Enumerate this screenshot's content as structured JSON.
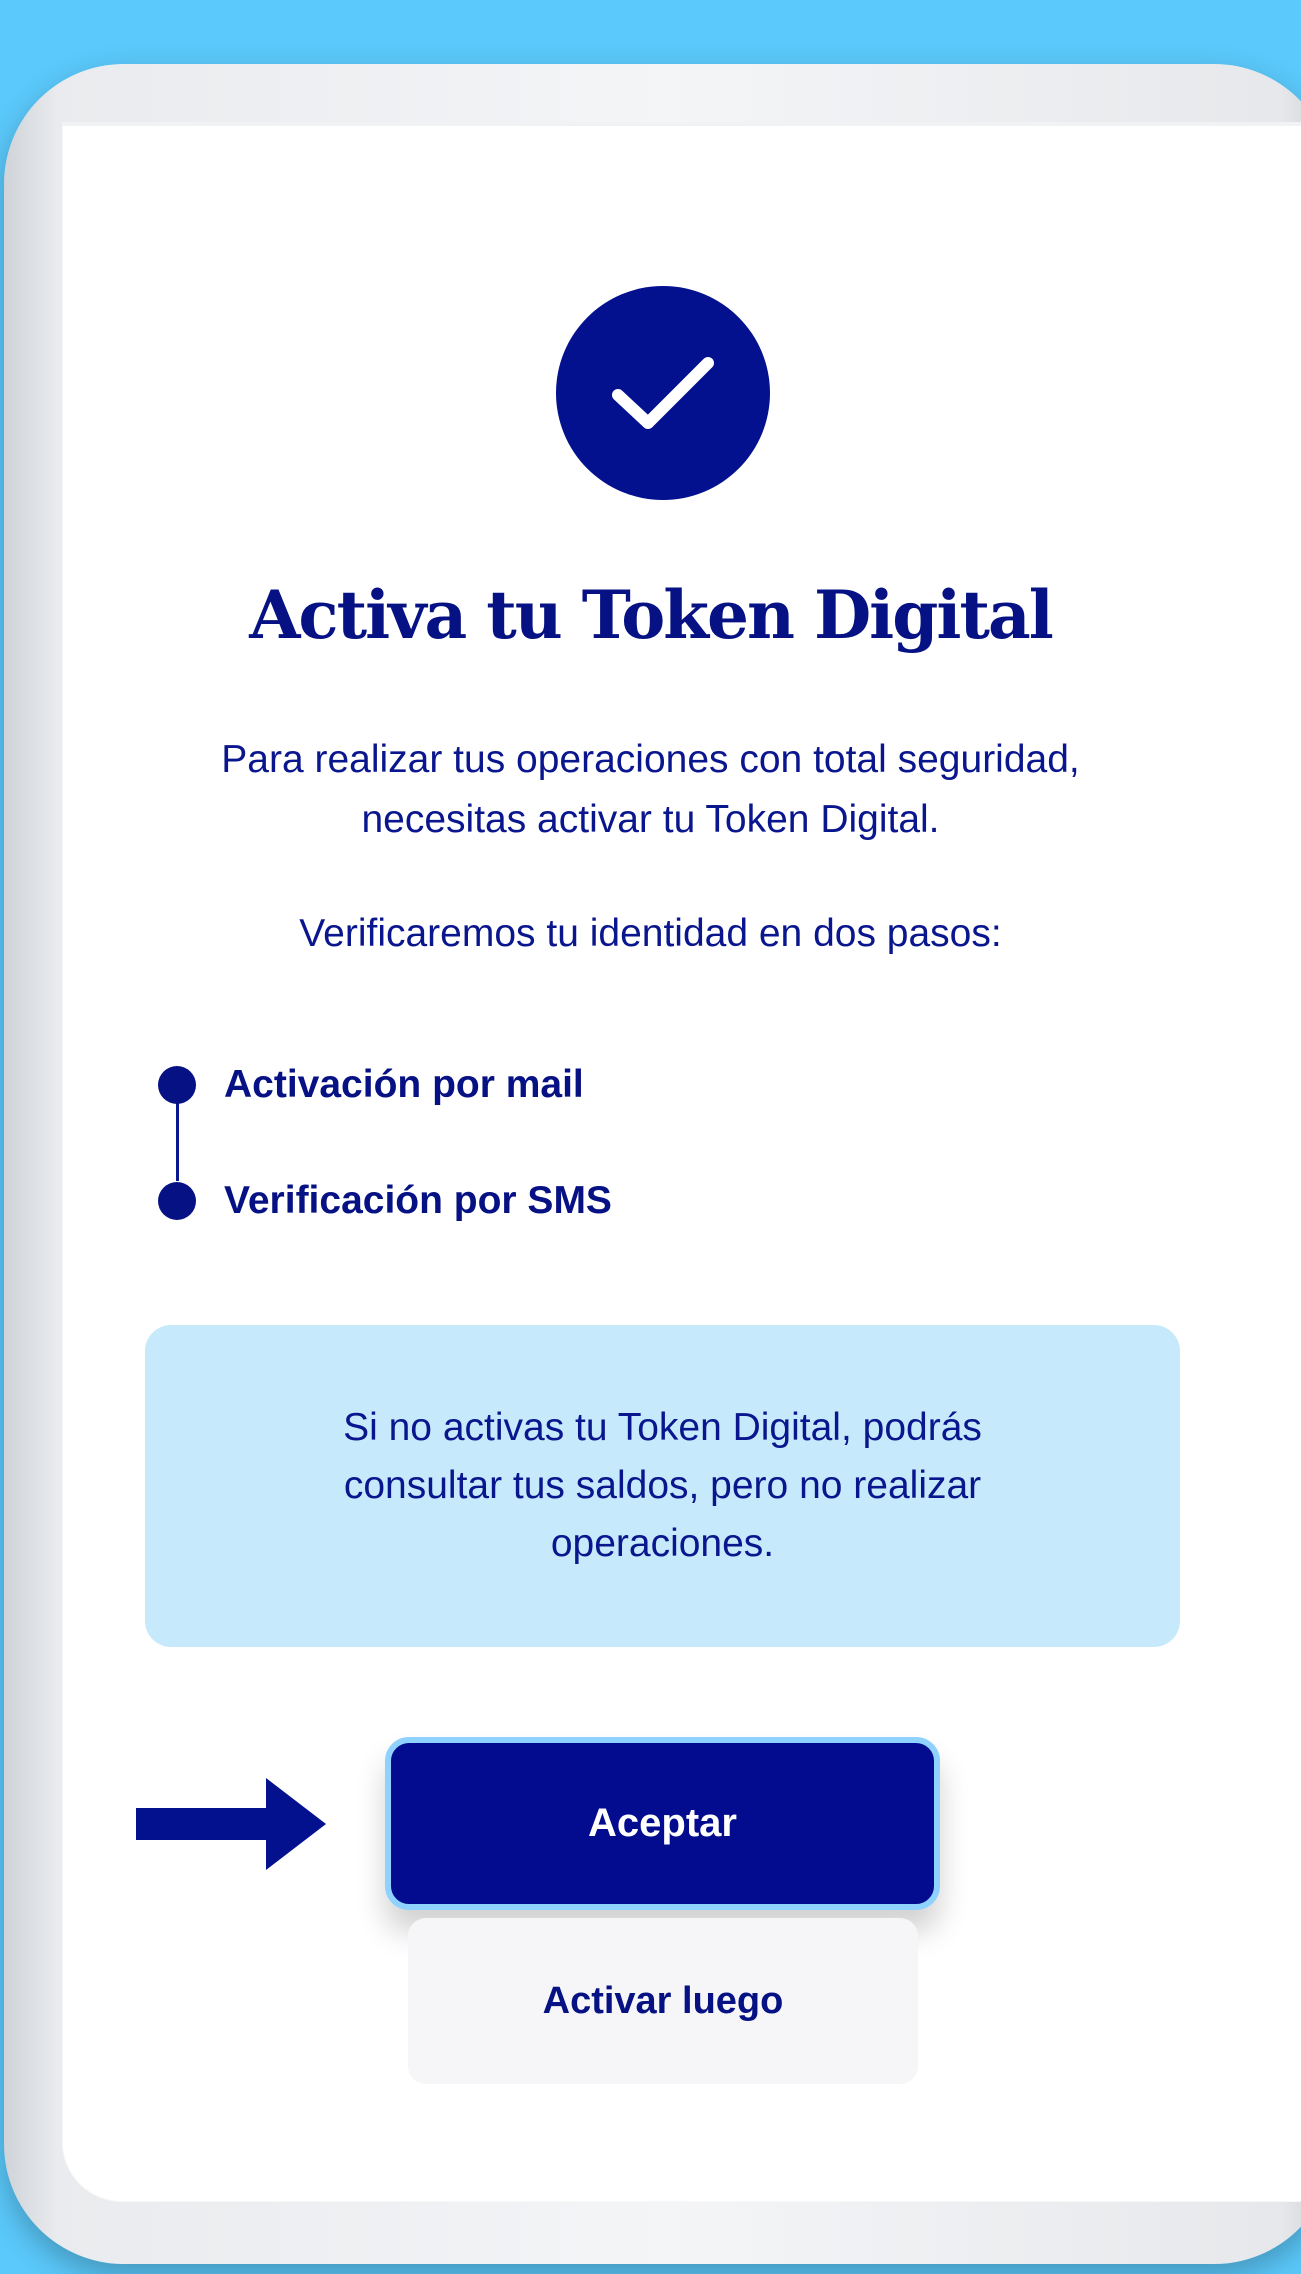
{
  "screen": {
    "title": "Activa tu Token Digital",
    "intro": "Para realizar tus operaciones con total seguridad, necesitas activar tu Token Digital.",
    "steps_intro": "Verificaremos tu identidad en dos pasos:",
    "steps": [
      {
        "label": "Activación por mail"
      },
      {
        "label": "Verificación por SMS"
      }
    ],
    "info": "Si no activas tu Token Digital, podrás consultar tus saldos, pero no realizar operaciones.",
    "accept_label": "Aceptar",
    "later_label": "Activar luego"
  },
  "icons": {
    "success": "check-icon",
    "pointer": "arrow-right-icon"
  },
  "colors": {
    "background": "#5bc9fb",
    "primary": "#04118e",
    "info_bg": "#c6eafb",
    "button_outline": "#8fd2ff",
    "secondary_button_bg": "#f6f6f8"
  }
}
